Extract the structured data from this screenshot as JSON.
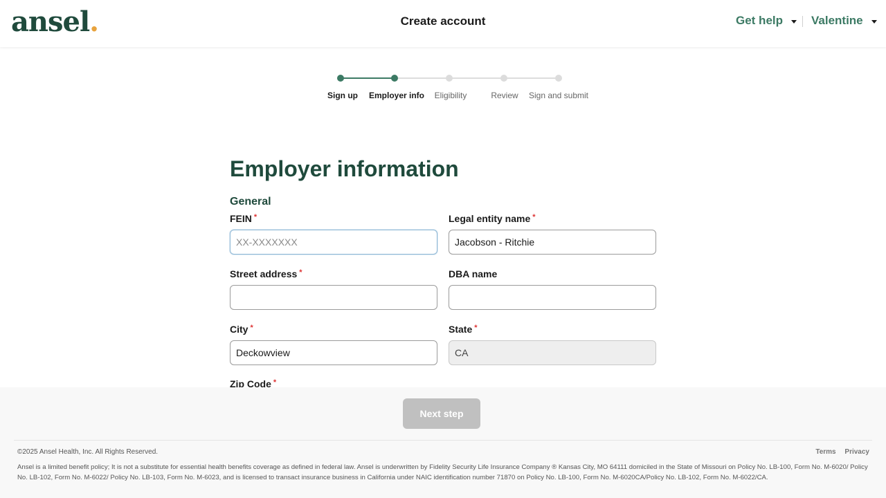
{
  "header": {
    "logo_text": "ansel",
    "logo_dot": ".",
    "title": "Create account",
    "help_label": "Get help",
    "user_label": "Valentine"
  },
  "stepper": {
    "steps": [
      {
        "label": "Sign up",
        "state": "complete"
      },
      {
        "label": "Employer info",
        "state": "current"
      },
      {
        "label": "Eligibility",
        "state": "upcoming"
      },
      {
        "label": "Review",
        "state": "upcoming"
      },
      {
        "label": "Sign and submit",
        "state": "upcoming"
      }
    ]
  },
  "main": {
    "title": "Employer information",
    "section": "General",
    "required_marker": "*",
    "fields": {
      "fein": {
        "label": "FEIN",
        "value": "",
        "placeholder": "XX-XXXXXXX",
        "required": true
      },
      "legal_entity_name": {
        "label": "Legal entity name",
        "value": "Jacobson - Ritchie",
        "required": true
      },
      "street_address": {
        "label": "Street address",
        "value": "",
        "required": true
      },
      "dba_name": {
        "label": "DBA name",
        "value": "",
        "required": false
      },
      "city": {
        "label": "City",
        "value": "Deckowview",
        "required": true
      },
      "state": {
        "label": "State",
        "value": "CA",
        "required": true,
        "disabled": true
      },
      "zip_code": {
        "label": "Zip Code",
        "required": true
      }
    }
  },
  "footer": {
    "next_button": "Next step",
    "copyright": "©2025 Ansel Health, Inc. All Rights Reserved.",
    "links": [
      "Terms",
      "Privacy"
    ],
    "disclaimer": "Ansel is a limited benefit policy; It is not a substitute for essential health benefits coverage as defined in federal law. Ansel is underwritten by Fidelity Security Life Insurance Company ® Kansas City, MO 64111 domiciled in the State of Missouri on Policy No. LB-100, Form No. M-6020/ Policy No. LB-102, Form No. M-6022/ Policy No. LB-103, Form No. M-6023, and is licensed to transact insurance business in California under NAIC identification number 71870 on Policy No. LB-100, Form No. M-6020CA/Policy No. LB-102, Form No. M-6022/CA."
  },
  "colors": {
    "brand_green": "#1f4a3c",
    "accent_green": "#3c7a64",
    "logo_dot": "#e8a33d",
    "required_red": "#dd3333",
    "disabled_button": "#c0c0c0"
  }
}
